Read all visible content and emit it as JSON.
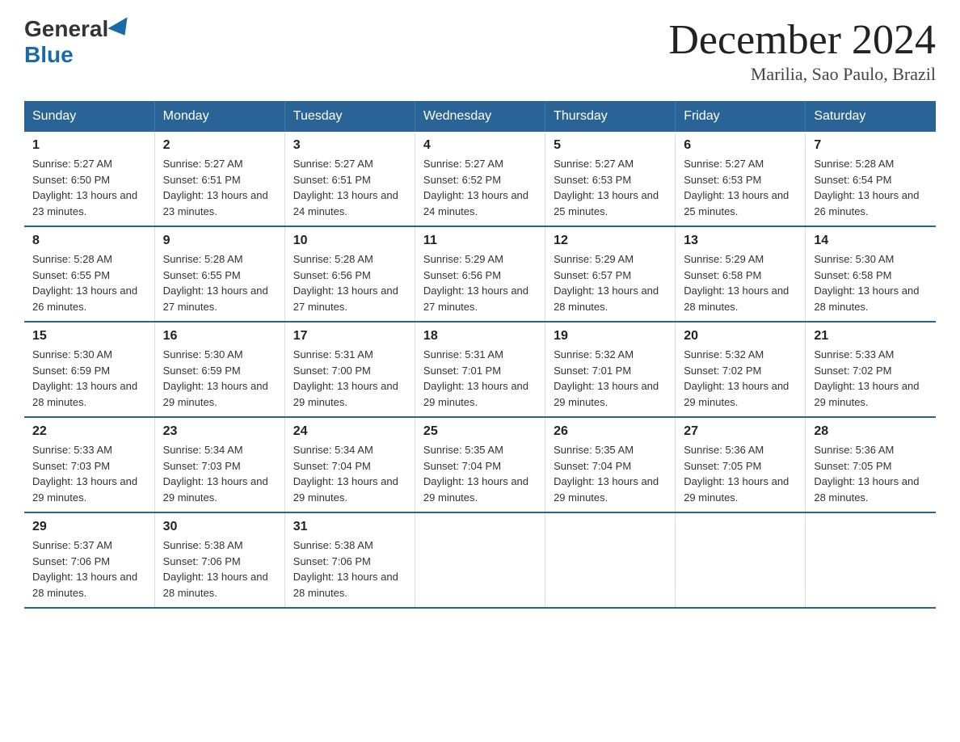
{
  "header": {
    "logo_general": "General",
    "logo_blue": "Blue",
    "month_year": "December 2024",
    "location": "Marilia, Sao Paulo, Brazil"
  },
  "weekdays": [
    "Sunday",
    "Monday",
    "Tuesday",
    "Wednesday",
    "Thursday",
    "Friday",
    "Saturday"
  ],
  "weeks": [
    [
      {
        "day": "1",
        "sunrise": "5:27 AM",
        "sunset": "6:50 PM",
        "daylight": "13 hours and 23 minutes."
      },
      {
        "day": "2",
        "sunrise": "5:27 AM",
        "sunset": "6:51 PM",
        "daylight": "13 hours and 23 minutes."
      },
      {
        "day": "3",
        "sunrise": "5:27 AM",
        "sunset": "6:51 PM",
        "daylight": "13 hours and 24 minutes."
      },
      {
        "day": "4",
        "sunrise": "5:27 AM",
        "sunset": "6:52 PM",
        "daylight": "13 hours and 24 minutes."
      },
      {
        "day": "5",
        "sunrise": "5:27 AM",
        "sunset": "6:53 PM",
        "daylight": "13 hours and 25 minutes."
      },
      {
        "day": "6",
        "sunrise": "5:27 AM",
        "sunset": "6:53 PM",
        "daylight": "13 hours and 25 minutes."
      },
      {
        "day": "7",
        "sunrise": "5:28 AM",
        "sunset": "6:54 PM",
        "daylight": "13 hours and 26 minutes."
      }
    ],
    [
      {
        "day": "8",
        "sunrise": "5:28 AM",
        "sunset": "6:55 PM",
        "daylight": "13 hours and 26 minutes."
      },
      {
        "day": "9",
        "sunrise": "5:28 AM",
        "sunset": "6:55 PM",
        "daylight": "13 hours and 27 minutes."
      },
      {
        "day": "10",
        "sunrise": "5:28 AM",
        "sunset": "6:56 PM",
        "daylight": "13 hours and 27 minutes."
      },
      {
        "day": "11",
        "sunrise": "5:29 AM",
        "sunset": "6:56 PM",
        "daylight": "13 hours and 27 minutes."
      },
      {
        "day": "12",
        "sunrise": "5:29 AM",
        "sunset": "6:57 PM",
        "daylight": "13 hours and 28 minutes."
      },
      {
        "day": "13",
        "sunrise": "5:29 AM",
        "sunset": "6:58 PM",
        "daylight": "13 hours and 28 minutes."
      },
      {
        "day": "14",
        "sunrise": "5:30 AM",
        "sunset": "6:58 PM",
        "daylight": "13 hours and 28 minutes."
      }
    ],
    [
      {
        "day": "15",
        "sunrise": "5:30 AM",
        "sunset": "6:59 PM",
        "daylight": "13 hours and 28 minutes."
      },
      {
        "day": "16",
        "sunrise": "5:30 AM",
        "sunset": "6:59 PM",
        "daylight": "13 hours and 29 minutes."
      },
      {
        "day": "17",
        "sunrise": "5:31 AM",
        "sunset": "7:00 PM",
        "daylight": "13 hours and 29 minutes."
      },
      {
        "day": "18",
        "sunrise": "5:31 AM",
        "sunset": "7:01 PM",
        "daylight": "13 hours and 29 minutes."
      },
      {
        "day": "19",
        "sunrise": "5:32 AM",
        "sunset": "7:01 PM",
        "daylight": "13 hours and 29 minutes."
      },
      {
        "day": "20",
        "sunrise": "5:32 AM",
        "sunset": "7:02 PM",
        "daylight": "13 hours and 29 minutes."
      },
      {
        "day": "21",
        "sunrise": "5:33 AM",
        "sunset": "7:02 PM",
        "daylight": "13 hours and 29 minutes."
      }
    ],
    [
      {
        "day": "22",
        "sunrise": "5:33 AM",
        "sunset": "7:03 PM",
        "daylight": "13 hours and 29 minutes."
      },
      {
        "day": "23",
        "sunrise": "5:34 AM",
        "sunset": "7:03 PM",
        "daylight": "13 hours and 29 minutes."
      },
      {
        "day": "24",
        "sunrise": "5:34 AM",
        "sunset": "7:04 PM",
        "daylight": "13 hours and 29 minutes."
      },
      {
        "day": "25",
        "sunrise": "5:35 AM",
        "sunset": "7:04 PM",
        "daylight": "13 hours and 29 minutes."
      },
      {
        "day": "26",
        "sunrise": "5:35 AM",
        "sunset": "7:04 PM",
        "daylight": "13 hours and 29 minutes."
      },
      {
        "day": "27",
        "sunrise": "5:36 AM",
        "sunset": "7:05 PM",
        "daylight": "13 hours and 29 minutes."
      },
      {
        "day": "28",
        "sunrise": "5:36 AM",
        "sunset": "7:05 PM",
        "daylight": "13 hours and 28 minutes."
      }
    ],
    [
      {
        "day": "29",
        "sunrise": "5:37 AM",
        "sunset": "7:06 PM",
        "daylight": "13 hours and 28 minutes."
      },
      {
        "day": "30",
        "sunrise": "5:38 AM",
        "sunset": "7:06 PM",
        "daylight": "13 hours and 28 minutes."
      },
      {
        "day": "31",
        "sunrise": "5:38 AM",
        "sunset": "7:06 PM",
        "daylight": "13 hours and 28 minutes."
      },
      null,
      null,
      null,
      null
    ]
  ]
}
